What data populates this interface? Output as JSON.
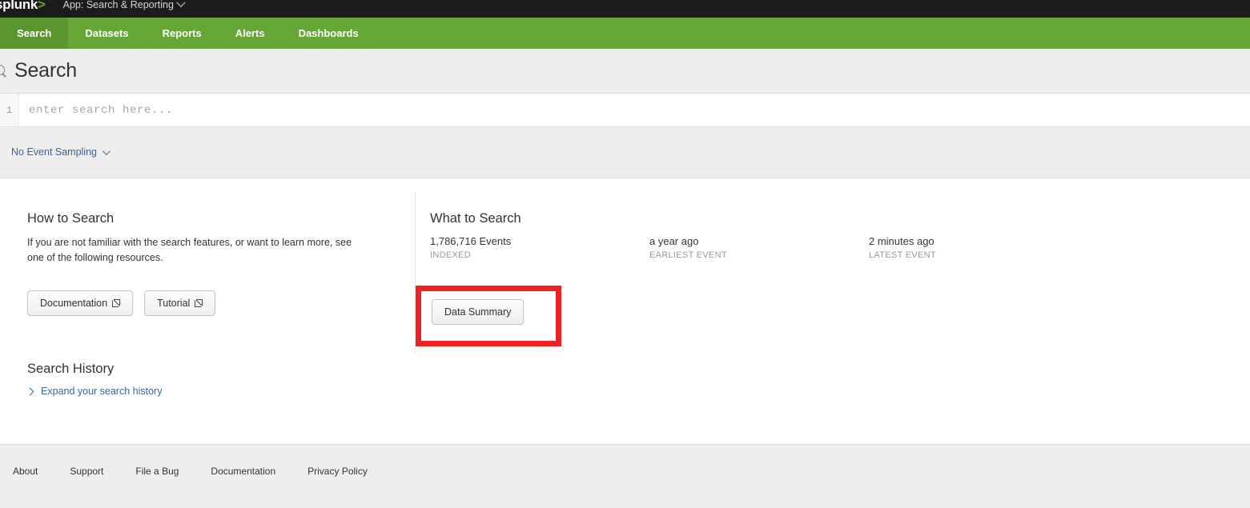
{
  "appbar": {
    "logo": "splunk",
    "logo_caret": ">",
    "app_menu": "App: Search & Reporting"
  },
  "nav": {
    "items": [
      {
        "label": "Search",
        "active": true
      },
      {
        "label": "Datasets",
        "active": false
      },
      {
        "label": "Reports",
        "active": false
      },
      {
        "label": "Alerts",
        "active": false
      },
      {
        "label": "Dashboards",
        "active": false
      }
    ]
  },
  "page": {
    "title": "Search",
    "search_icon": "search-icon"
  },
  "search": {
    "line_number": "1",
    "value": "",
    "placeholder": "enter search here..."
  },
  "sampling": {
    "label": "No Event Sampling",
    "caret_icon": "chevron-down-icon"
  },
  "how_to_search": {
    "title": "How to Search",
    "body": "If you are not familiar with the search features, or want to learn more, see one of the following resources.",
    "buttons": [
      {
        "label": "Documentation",
        "icon": "external-link-icon"
      },
      {
        "label": "Tutorial",
        "icon": "external-link-icon"
      }
    ]
  },
  "what_to_search": {
    "title": "What to Search",
    "stats": [
      {
        "value": "1,786,716 Events",
        "label": "INDEXED"
      },
      {
        "value": "a year ago",
        "label": "EARLIEST EVENT"
      },
      {
        "value": "2 minutes ago",
        "label": "LATEST EVENT"
      }
    ],
    "data_summary_button": "Data Summary"
  },
  "search_history": {
    "title": "Search History",
    "expand_label": "Expand your search history",
    "expand_icon": "chevron-right-icon"
  },
  "footer": {
    "links": [
      "About",
      "Support",
      "File a Bug",
      "Documentation",
      "Privacy Policy"
    ]
  },
  "colors": {
    "nav_green": "#65a637",
    "nav_green_active": "#5a9530",
    "appbar_black": "#1c1c1c",
    "link_blue": "#3863a0",
    "annotation_red": "#ee2222",
    "panel_gray": "#eeeeee"
  }
}
